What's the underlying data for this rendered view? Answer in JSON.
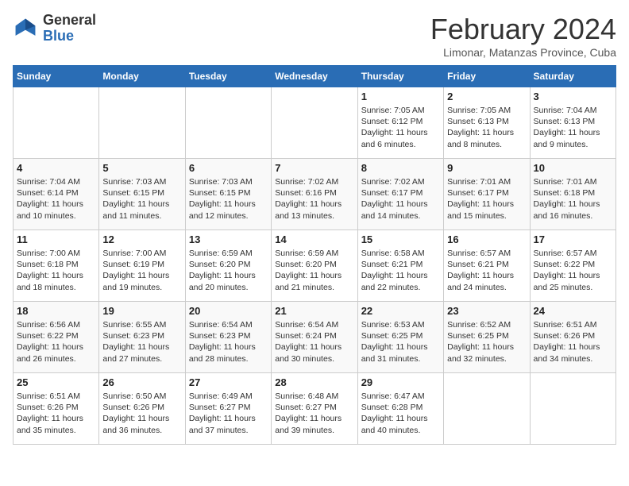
{
  "header": {
    "logo_general": "General",
    "logo_blue": "Blue",
    "month_year": "February 2024",
    "location": "Limonar, Matanzas Province, Cuba"
  },
  "days_of_week": [
    "Sunday",
    "Monday",
    "Tuesday",
    "Wednesday",
    "Thursday",
    "Friday",
    "Saturday"
  ],
  "weeks": [
    [
      {
        "day": "",
        "info": ""
      },
      {
        "day": "",
        "info": ""
      },
      {
        "day": "",
        "info": ""
      },
      {
        "day": "",
        "info": ""
      },
      {
        "day": "1",
        "info": "Sunrise: 7:05 AM\nSunset: 6:12 PM\nDaylight: 11 hours and 6 minutes."
      },
      {
        "day": "2",
        "info": "Sunrise: 7:05 AM\nSunset: 6:13 PM\nDaylight: 11 hours and 8 minutes."
      },
      {
        "day": "3",
        "info": "Sunrise: 7:04 AM\nSunset: 6:13 PM\nDaylight: 11 hours and 9 minutes."
      }
    ],
    [
      {
        "day": "4",
        "info": "Sunrise: 7:04 AM\nSunset: 6:14 PM\nDaylight: 11 hours and 10 minutes."
      },
      {
        "day": "5",
        "info": "Sunrise: 7:03 AM\nSunset: 6:15 PM\nDaylight: 11 hours and 11 minutes."
      },
      {
        "day": "6",
        "info": "Sunrise: 7:03 AM\nSunset: 6:15 PM\nDaylight: 11 hours and 12 minutes."
      },
      {
        "day": "7",
        "info": "Sunrise: 7:02 AM\nSunset: 6:16 PM\nDaylight: 11 hours and 13 minutes."
      },
      {
        "day": "8",
        "info": "Sunrise: 7:02 AM\nSunset: 6:17 PM\nDaylight: 11 hours and 14 minutes."
      },
      {
        "day": "9",
        "info": "Sunrise: 7:01 AM\nSunset: 6:17 PM\nDaylight: 11 hours and 15 minutes."
      },
      {
        "day": "10",
        "info": "Sunrise: 7:01 AM\nSunset: 6:18 PM\nDaylight: 11 hours and 16 minutes."
      }
    ],
    [
      {
        "day": "11",
        "info": "Sunrise: 7:00 AM\nSunset: 6:18 PM\nDaylight: 11 hours and 18 minutes."
      },
      {
        "day": "12",
        "info": "Sunrise: 7:00 AM\nSunset: 6:19 PM\nDaylight: 11 hours and 19 minutes."
      },
      {
        "day": "13",
        "info": "Sunrise: 6:59 AM\nSunset: 6:20 PM\nDaylight: 11 hours and 20 minutes."
      },
      {
        "day": "14",
        "info": "Sunrise: 6:59 AM\nSunset: 6:20 PM\nDaylight: 11 hours and 21 minutes."
      },
      {
        "day": "15",
        "info": "Sunrise: 6:58 AM\nSunset: 6:21 PM\nDaylight: 11 hours and 22 minutes."
      },
      {
        "day": "16",
        "info": "Sunrise: 6:57 AM\nSunset: 6:21 PM\nDaylight: 11 hours and 24 minutes."
      },
      {
        "day": "17",
        "info": "Sunrise: 6:57 AM\nSunset: 6:22 PM\nDaylight: 11 hours and 25 minutes."
      }
    ],
    [
      {
        "day": "18",
        "info": "Sunrise: 6:56 AM\nSunset: 6:22 PM\nDaylight: 11 hours and 26 minutes."
      },
      {
        "day": "19",
        "info": "Sunrise: 6:55 AM\nSunset: 6:23 PM\nDaylight: 11 hours and 27 minutes."
      },
      {
        "day": "20",
        "info": "Sunrise: 6:54 AM\nSunset: 6:23 PM\nDaylight: 11 hours and 28 minutes."
      },
      {
        "day": "21",
        "info": "Sunrise: 6:54 AM\nSunset: 6:24 PM\nDaylight: 11 hours and 30 minutes."
      },
      {
        "day": "22",
        "info": "Sunrise: 6:53 AM\nSunset: 6:25 PM\nDaylight: 11 hours and 31 minutes."
      },
      {
        "day": "23",
        "info": "Sunrise: 6:52 AM\nSunset: 6:25 PM\nDaylight: 11 hours and 32 minutes."
      },
      {
        "day": "24",
        "info": "Sunrise: 6:51 AM\nSunset: 6:26 PM\nDaylight: 11 hours and 34 minutes."
      }
    ],
    [
      {
        "day": "25",
        "info": "Sunrise: 6:51 AM\nSunset: 6:26 PM\nDaylight: 11 hours and 35 minutes."
      },
      {
        "day": "26",
        "info": "Sunrise: 6:50 AM\nSunset: 6:26 PM\nDaylight: 11 hours and 36 minutes."
      },
      {
        "day": "27",
        "info": "Sunrise: 6:49 AM\nSunset: 6:27 PM\nDaylight: 11 hours and 37 minutes."
      },
      {
        "day": "28",
        "info": "Sunrise: 6:48 AM\nSunset: 6:27 PM\nDaylight: 11 hours and 39 minutes."
      },
      {
        "day": "29",
        "info": "Sunrise: 6:47 AM\nSunset: 6:28 PM\nDaylight: 11 hours and 40 minutes."
      },
      {
        "day": "",
        "info": ""
      },
      {
        "day": "",
        "info": ""
      }
    ]
  ]
}
